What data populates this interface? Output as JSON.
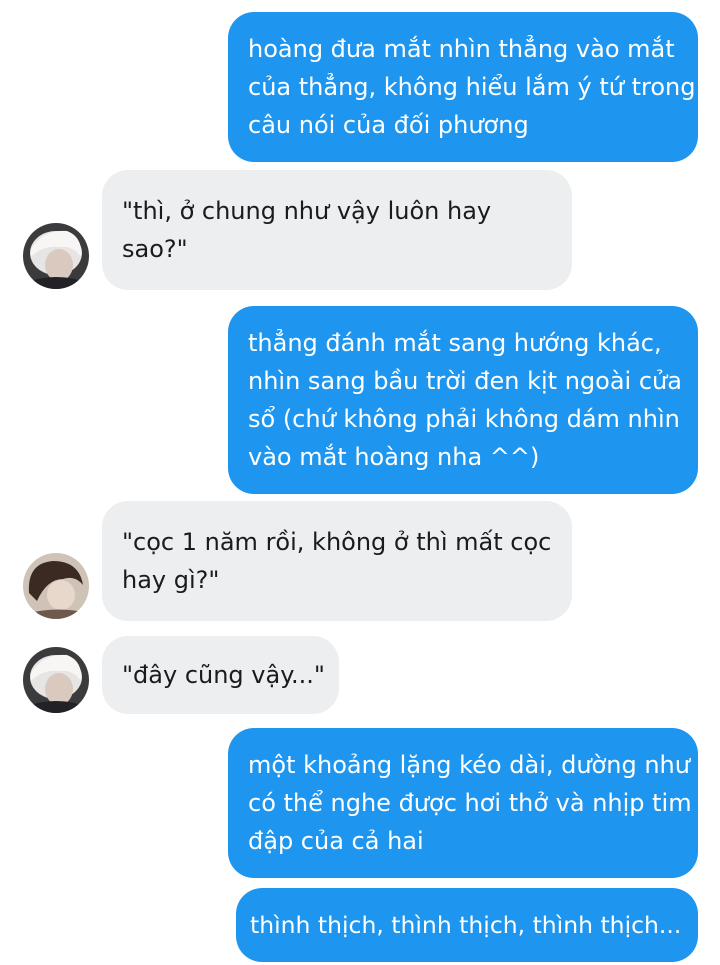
{
  "messages": [
    {
      "sender": "me",
      "lines": [
        "hoàng đưa mắt nhìn thẳng vào mắt",
        "của thẳng, không hiểu lắm ý tứ trong",
        "câu nói của đối phương"
      ]
    },
    {
      "sender": "other",
      "avatar": "avatar-white-hair",
      "lines": [
        "\"thì, ở chung như vậy luôn hay",
        "sao?\""
      ]
    },
    {
      "sender": "me",
      "lines": [
        "thẳng đánh mắt sang hướng khác,",
        "nhìn sang bầu trời đen kịt ngoài cửa",
        "sổ (chứ không phải không dám nhìn",
        "vào mắt hoàng nha ^^)"
      ]
    },
    {
      "sender": "other",
      "avatar": "avatar-dark-hair",
      "lines": [
        "\"cọc 1 năm rồi, không ở thì mất cọc",
        "hay gì?\""
      ]
    },
    {
      "sender": "other",
      "avatar": "avatar-white-hair",
      "lines": [
        "\"đây cũng vậy...\""
      ]
    },
    {
      "sender": "me",
      "lines": [
        "một khoảng lặng kéo dài, dường như",
        "có thể nghe được hơi thở và nhịp tim",
        "đập của cả hai"
      ]
    },
    {
      "sender": "me",
      "lines": [
        "thình thịch, thình thịch, thình thịch..."
      ]
    }
  ],
  "colors": {
    "outgoing_bubble": "#1e96f0",
    "incoming_bubble": "#eceef0",
    "outgoing_text": "#ffffff",
    "incoming_text": "#1b1b1b"
  }
}
